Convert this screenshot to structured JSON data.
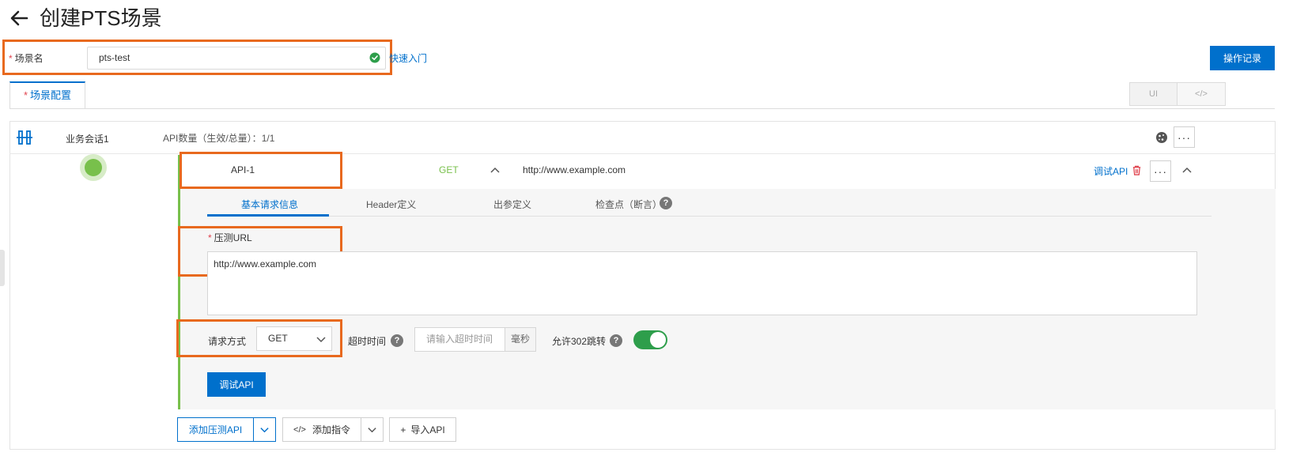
{
  "header": {
    "title": "创建PTS场景"
  },
  "scene": {
    "name_label": "场景名",
    "required_mark": "*",
    "name_value": "pts-test",
    "quick_link": "快速入门",
    "op_record_button": "操作记录"
  },
  "tabs": {
    "main_tab": "场景配置",
    "mode_ui": "UI",
    "mode_code": "</>"
  },
  "session": {
    "name": "业务会话1",
    "api_count_label": "API数量（生效/总量）：",
    "api_count_value": "1/1",
    "more": "···"
  },
  "api": {
    "name": "API-1",
    "method": "GET",
    "url": "http://www.example.com",
    "debug_link": "调试API",
    "more": "···",
    "subtabs": [
      "基本请求信息",
      "Header定义",
      "出参定义",
      "检查点（断言）"
    ],
    "help": "?",
    "url_label": "压测URL",
    "url_value": "http://www.example.com",
    "method_label": "请求方式",
    "method_value": "GET",
    "timeout_label": "超时时间",
    "timeout_placeholder": "请输入超时时间",
    "timeout_unit": "毫秒",
    "redirect_label": "允许302跳转",
    "redirect_enabled": true,
    "debug_button": "调试API"
  },
  "footer_buttons": {
    "add_api": "添加压测API",
    "add_command_icon": "</>",
    "add_command": "添加指令",
    "import_api_icon": "+",
    "import_api": "导入API"
  },
  "colors": {
    "primary": "#0070cc",
    "highlight": "#e8691e",
    "api_green": "#78c04b",
    "toggle_on": "#2e9e4b",
    "required": "#e0434e"
  }
}
